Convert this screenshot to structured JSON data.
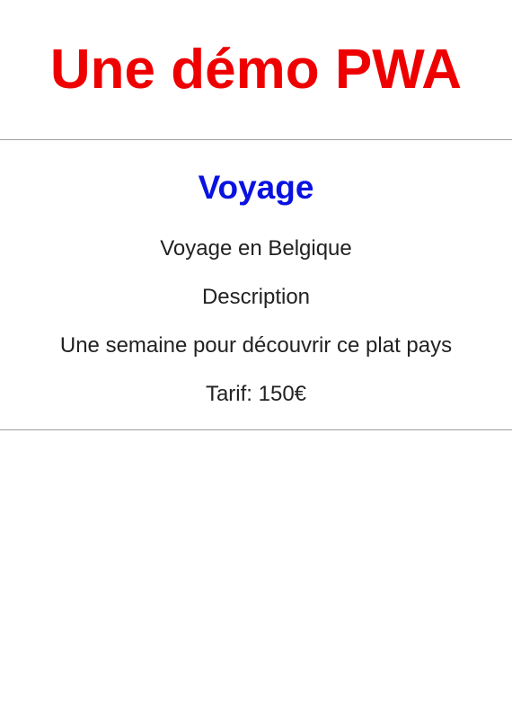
{
  "header": {
    "title": "Une démo PWA"
  },
  "trip": {
    "heading": "Voyage",
    "name": "Voyage en Belgique",
    "description_label": "Description",
    "description": "Une semaine pour découvrir ce plat pays",
    "price": "Tarif: 150€"
  },
  "colors": {
    "title": "#ee0000",
    "heading": "#0a12e0",
    "text": "#222222",
    "divider": "#a0a0a0"
  }
}
